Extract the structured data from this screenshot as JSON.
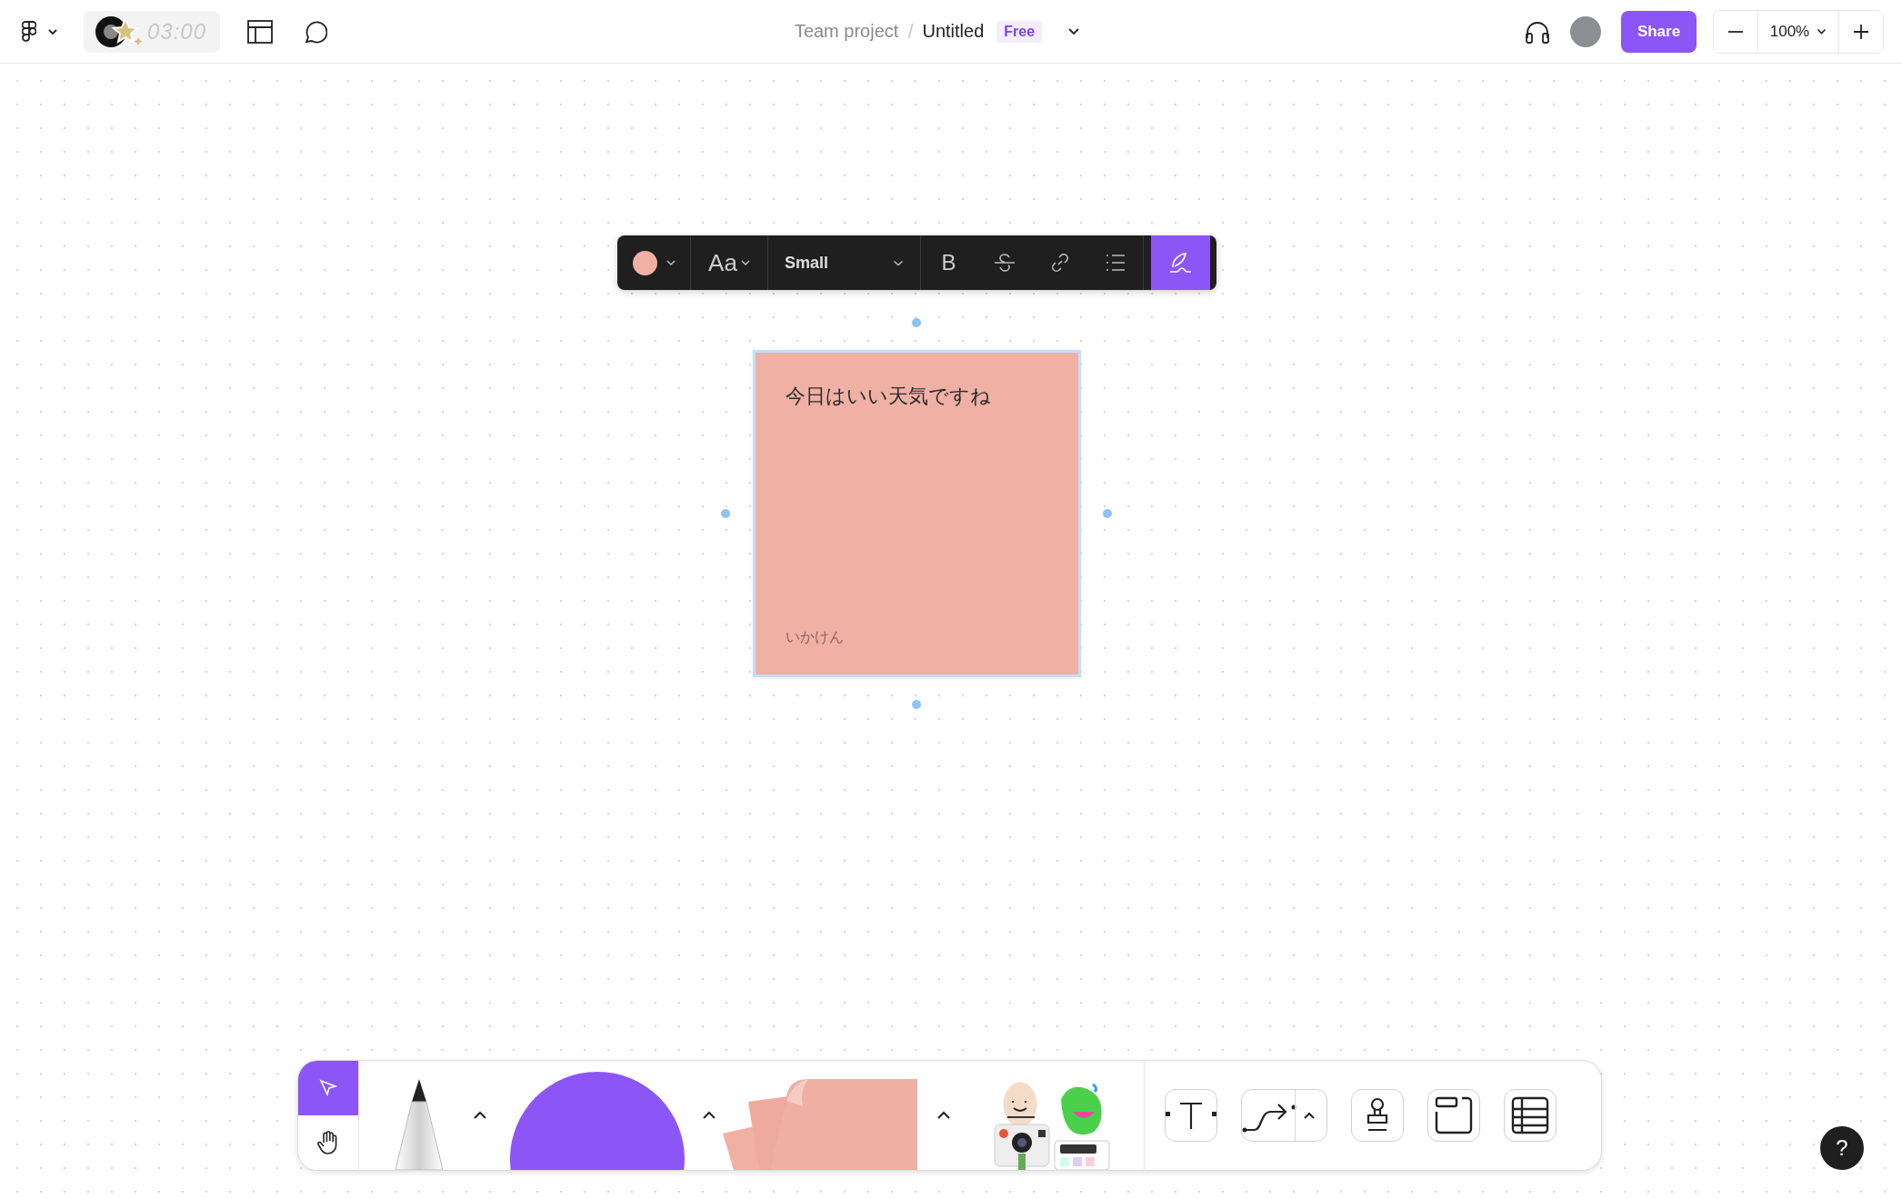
{
  "top_bar": {
    "timer": "03:00",
    "breadcrumb": {
      "team": "Team project",
      "separator": "/",
      "file": "Untitled",
      "plan_badge": "Free"
    },
    "share_button": "Share",
    "zoom": "100%"
  },
  "format_toolbar": {
    "font_button": "Aa",
    "size_select": "Small",
    "tools": [
      {
        "kind": "bold",
        "label": "B",
        "selected": false
      },
      {
        "kind": "strikethrough",
        "selected": false
      },
      {
        "kind": "link",
        "selected": false
      },
      {
        "kind": "list",
        "selected": false
      },
      {
        "kind": "signature",
        "selected": true
      }
    ]
  },
  "sticky_note": {
    "text": "今日はいい天気ですね",
    "author": "いかけん",
    "color": "#f0b0a4",
    "selected": true
  },
  "bottom_toolbar": {
    "pointer_tools": [
      {
        "kind": "select",
        "selected": true
      },
      {
        "kind": "hand",
        "selected": false
      }
    ],
    "tools": [
      {
        "kind": "text"
      },
      {
        "kind": "connector"
      },
      {
        "kind": "stamp"
      },
      {
        "kind": "section"
      },
      {
        "kind": "table"
      }
    ]
  },
  "help_button": "?"
}
